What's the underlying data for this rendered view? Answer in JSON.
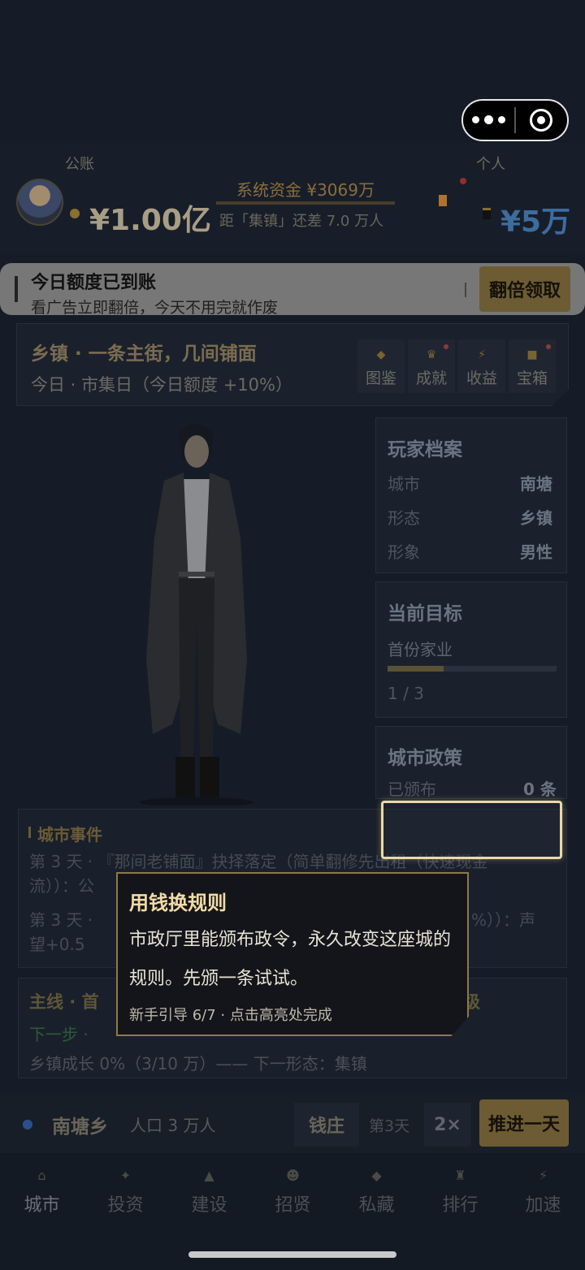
{
  "capsule": {
    "menu_icon": "dots-icon",
    "close_icon": "target-icon"
  },
  "header": {
    "public_label": "公账",
    "personal_label": "个人",
    "public_amount": "¥1.00亿",
    "system_fund": "系统资金 ¥3069万",
    "gap_text": "距「集镇」还差 7.0 万人",
    "personal_amount": "¥5万"
  },
  "banner": {
    "title": "今日额度已到账",
    "subtitle": "看广告立即翻倍，今天不用完就作废",
    "button": "翻倍领取"
  },
  "town": {
    "title": "乡镇 · 一条主街，几间铺面",
    "subtitle": "今日 · 市集日（今日额度 +10%）",
    "tabs": [
      {
        "label": "图鉴",
        "icon": "diamond-icon"
      },
      {
        "label": "成就",
        "icon": "trophy-icon"
      },
      {
        "label": "收益",
        "icon": "lightning-icon"
      },
      {
        "label": "宝箱",
        "icon": "chest-icon"
      }
    ]
  },
  "profile": {
    "title": "玩家档案",
    "rows": [
      {
        "key": "城市",
        "value": "南塘"
      },
      {
        "key": "形态",
        "value": "乡镇"
      },
      {
        "key": "形象",
        "value": "男性"
      }
    ]
  },
  "goal": {
    "title": "当前目标",
    "name": "首份家业",
    "progress": "1 / 3",
    "progress_fraction": 0.33
  },
  "policy": {
    "title": "城市政策",
    "key": "已颁布",
    "value": "0 条"
  },
  "events": {
    "title": "城市事件",
    "line1": "第 3 天 · 『那间老铺面』抉择落定（简单翻修先出租（快速现金",
    "line2": "流））：公",
    "line3_start": "第 3 天 ·",
    "line3_end": "%））：声",
    "line4": "望+0.5"
  },
  "mainline": {
    "title_start": "主线 · 首",
    "title_end": "级",
    "next_step": "下一步 ·",
    "growth": "乡镇成长 0%（3/10 万）—— 下一形态：集镇"
  },
  "tooltip": {
    "title": "用钱换规则",
    "body": "市政厅里能颁布政令，永久改变这座城的规则。先颁一条试试。",
    "footer": "新手引导 6/7 · 点击高亮处完成"
  },
  "status": {
    "town_name": "南塘乡",
    "population": "人口 3 万人",
    "bank": "钱庄",
    "day": "第3天",
    "speed": "2×",
    "advance": "推进一天"
  },
  "nav": [
    {
      "label": "城市",
      "icon": "city-icon"
    },
    {
      "label": "投资",
      "icon": "invest-icon"
    },
    {
      "label": "建设",
      "icon": "build-icon"
    },
    {
      "label": "招贤",
      "icon": "recruit-icon"
    },
    {
      "label": "私藏",
      "icon": "gem-icon"
    },
    {
      "label": "排行",
      "icon": "rank-icon"
    },
    {
      "label": "加速",
      "icon": "lightning-icon"
    }
  ]
}
